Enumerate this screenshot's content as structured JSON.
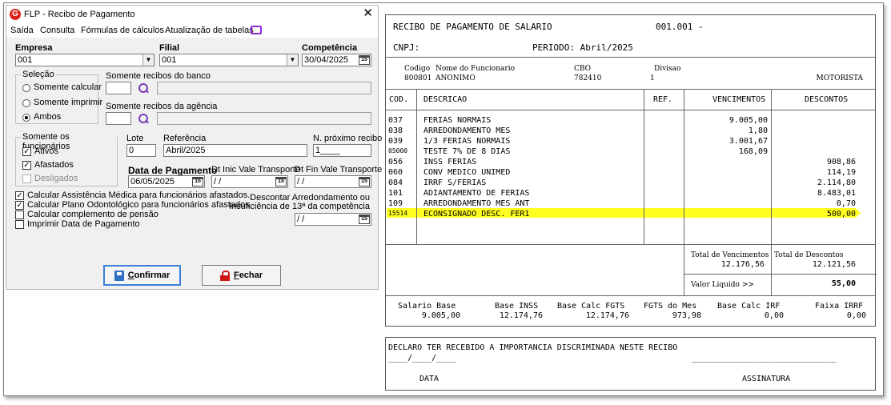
{
  "window": {
    "title": "FLP - Recibo de Pagamento",
    "close": "✕"
  },
  "menu": [
    "Saída",
    "Consulta",
    "Fórmulas de cálculos",
    "Atualização de tabelas"
  ],
  "form": {
    "empresa_label": "Empresa",
    "empresa_value": "001",
    "filial_label": "Filial",
    "filial_value": "001",
    "competencia_label": "Competência",
    "competencia_value": "30/04/2025",
    "selecao_label": "Seleção",
    "opt_calc": "Somente calcular",
    "opt_print": "Somente imprimir",
    "opt_both": "Ambos",
    "banco_label": "Somente recibos do banco",
    "agencia_label": "Somente recibos da agência",
    "func_label": "Somente os funcionários",
    "ativos": "Ativos",
    "afastados": "Afastados",
    "desligados": "Desligados",
    "lote_label": "Lote",
    "lote_value": "0",
    "referencia_label": "Referência",
    "referencia_value": "Abril/2025",
    "prox_recibo_label": "N. próximo recibo",
    "prox_recibo_value": "1____",
    "data_pag_label": "Data de Pagamento",
    "data_pag_value": "06/05/2025",
    "dt_ini_label": "Dt Inic Vale Transporte",
    "dt_ini_value": "/ /",
    "dt_fin_label": "Dt Fin Vale Transporte",
    "dt_fin_value": "/ /",
    "chk_assist": "Calcular Assistência Médica para funcionários afastados.",
    "chk_odonto": "Calcular Plano Odontológico para funcionários afastados.",
    "chk_pensao": "Calcular complemento de pensão",
    "chk_imprimir": "Imprimir Data de Pagamento",
    "descontar_line1": "Descontar Arredondamento ou",
    "descontar_line2": "Insuficiência de 13ª da competência",
    "descontar_value": "/ /",
    "confirm_pre": "",
    "confirm_ul": "C",
    "confirm_post": "onfirmar",
    "close_ul": "F",
    "close_post": "echar"
  },
  "receipt": {
    "title": "RECIBO DE PAGAMENTO DE SALARIO",
    "number": "001.001 -",
    "cnpj": "CNPJ:",
    "periodo": "PERIODO: Abril/2025",
    "h_codigo": "Codigo",
    "h_nome": "Nome do Funcionario",
    "h_cbo": "CBO",
    "h_divisao": "Divisao",
    "codigo": "800801",
    "nome": "ANONIMO",
    "cbo": "782410",
    "divisao": "1",
    "cargo": "MOTORISTA",
    "col_cod": "COD.",
    "col_desc": "DESCRICAO",
    "col_ref": "REF.",
    "col_venc": "VENCIMENTOS",
    "col_descontos": "DESCONTOS",
    "rows": [
      {
        "cod": "037",
        "desc": "FERIAS NORMAIS",
        "venc": "9.005,00",
        "dsc": ""
      },
      {
        "cod": "038",
        "desc": "ARREDONDAMENTO MES",
        "venc": "1,80",
        "dsc": ""
      },
      {
        "cod": "039",
        "desc": "1/3 FERIAS NORMAIS",
        "venc": "3.001,67",
        "dsc": ""
      },
      {
        "cod": "05000",
        "desc": "TESTE 7% DE 8 DIAS",
        "venc": "168,09",
        "dsc": ""
      },
      {
        "cod": "056",
        "desc": "INSS FERIAS",
        "venc": "",
        "dsc": "908,86"
      },
      {
        "cod": "060",
        "desc": "CONV MEDICO UNIMED",
        "venc": "",
        "dsc": "114,19"
      },
      {
        "cod": "084",
        "desc": "IRRF S/FERIAS",
        "venc": "",
        "dsc": "2.114,80"
      },
      {
        "cod": "101",
        "desc": "ADIANTAMENTO DE FERIAS",
        "venc": "",
        "dsc": "8.483,01"
      },
      {
        "cod": "109",
        "desc": "ARREDONDAMENTO MES ANT",
        "venc": "",
        "dsc": "0,70"
      },
      {
        "cod": "15514",
        "desc": "ECONSIGNADO DESC. FER1",
        "venc": "",
        "dsc": "500,00"
      }
    ],
    "total_venc_label": "Total de Vencimentos",
    "total_venc": "12.176,56",
    "total_desc_label": "Total de Descontos",
    "total_desc": "12.121,56",
    "liquido_label": "Valor Liquido >>",
    "liquido": "55,00",
    "f_sal_label": "Salario Base",
    "f_sal": "9.005,00",
    "f_inss_label": "Base INSS",
    "f_inss": "12.174,76",
    "f_fgts_label": "Base Calc FGTS",
    "f_fgts": "12.174,76",
    "f_fgtsm_label": "FGTS do Mes",
    "f_fgtsm": "973,98",
    "f_irrf_label": "Base Calc IRF",
    "f_irrf": "0,00",
    "f_faixa_label": "Faixa IRRF",
    "f_faixa": "0,00"
  },
  "declaration": {
    "text": "DECLARO TER RECEBIDO A IMPORTANCIA DISCRIMINADA NESTE RECIBO",
    "date_line": "____/____/____",
    "sig_line": "______________________________",
    "date_label": "DATA",
    "sig_label": "ASSINATURA"
  },
  "colors": {
    "highlight": "#ffff22",
    "accent": "#3c7fd8",
    "logo": "#d9241c"
  }
}
